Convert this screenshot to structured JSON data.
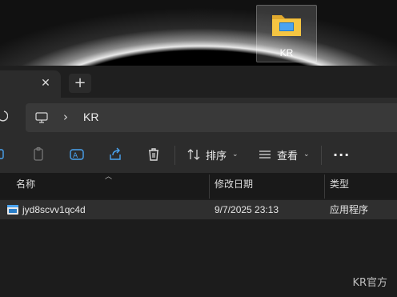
{
  "desktop": {
    "icon": {
      "label": "KR",
      "icon": "folder-icon"
    }
  },
  "tabs": {
    "close_symbol": "✕",
    "new_tab_symbol": "+"
  },
  "address": {
    "chevron": "›",
    "crumb": "KR"
  },
  "toolbar": {
    "sort_label": "排序",
    "view_label": "查看",
    "caret": "⌄",
    "more_symbol": "···",
    "icons": [
      "cut-icon",
      "copy-icon",
      "rename-icon",
      "share-icon",
      "delete-icon",
      "sort-icon",
      "view-icon",
      "more-icon"
    ]
  },
  "columns": {
    "name": "名称",
    "modified": "修改日期",
    "type": "类型"
  },
  "files": [
    {
      "name": "jyd8scvv1qc4d",
      "modified": "9/7/2025 23:13",
      "type": "应用程序"
    }
  ],
  "watermark": "KR官方",
  "colors": {
    "folder": "#f5c542",
    "accent": "#4aa3f0"
  }
}
